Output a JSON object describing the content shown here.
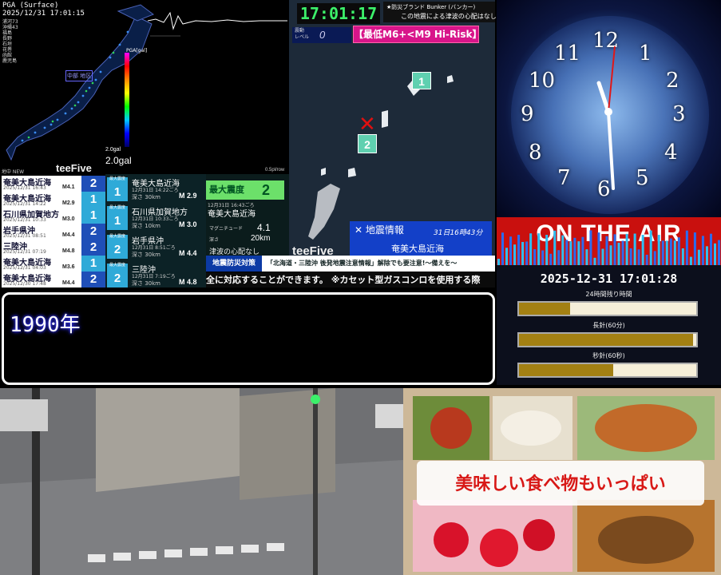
{
  "seismic": {
    "title": "PGA (Surface)",
    "timestamp": "2025/12/31 17:01:15",
    "scale_unit": "PGA[gal]",
    "gal_small": "2.0gal",
    "gal_value": "2.0gal",
    "logo": "teeFive",
    "spl_label": "0.5pl/row",
    "map_place": "中部 地区",
    "station_names": [
      "浦河73",
      "沖縄43",
      "福島",
      "長野",
      "石垣",
      "花巻",
      "函館",
      "鹿児島"
    ]
  },
  "top_clock": {
    "time": "17:01:17",
    "bunker_line1": "★防災ブランド Bunker (バンカー)",
    "bunker_line2": "この地震による津波の心配はなし"
  },
  "tsunami_map": {
    "level_label_1": "震動",
    "level_label_2": "レベル",
    "level_value": "0",
    "risk_label": "【最低M6+<M9 Hi-Risk】",
    "marker_1": "1",
    "marker_2": "2",
    "epicenter": "✕",
    "quake_title": "✕ 地震情報",
    "quake_time": "31日16時43分",
    "quake_place": "奄美大島近海",
    "logo": "teeFive"
  },
  "event_list": {
    "header": "地中 NEW",
    "rows": [
      {
        "name": "奄美大島近海",
        "date": "2025/12/31 16:43",
        "mag": "M4.1",
        "intensity": "2",
        "color": "#1f4fb8"
      },
      {
        "name": "奄美大島近海",
        "date": "2025/12/31 14:22",
        "mag": "M2.9",
        "intensity": "1",
        "color": "#2faad8"
      },
      {
        "name": "石川県加賀地方",
        "date": "2025/12/31 10:33",
        "mag": "M3.0",
        "intensity": "1",
        "color": "#2faad8"
      },
      {
        "name": "岩手県沖",
        "date": "2025/12/31 08:51",
        "mag": "M4.4",
        "intensity": "2",
        "color": "#1f4fb8"
      },
      {
        "name": "三陸沖",
        "date": "2025/12/31 07:19",
        "mag": "M4.8",
        "intensity": "2",
        "color": "#1f4fb8"
      },
      {
        "name": "奄美大島近海",
        "date": "2025/12/31 04:03",
        "mag": "M3.6",
        "intensity": "1",
        "color": "#2faad8"
      },
      {
        "name": "奄美大島近海",
        "date": "2025/12/30 17:48",
        "mag": "M4.4",
        "intensity": "2",
        "color": "#1f4fb8"
      }
    ]
  },
  "detail_list": [
    {
      "name": "奄美大島近海",
      "date": "12月31日 14:22ごろ",
      "depth": "深さ 30km",
      "mag": "M 2.9",
      "intensity": "1"
    },
    {
      "name": "石川県加賀地方",
      "date": "12月31日 10:33ごろ",
      "depth": "深さ 10km",
      "mag": "M 3.0",
      "intensity": "1"
    },
    {
      "name": "岩手県沖",
      "date": "12月31日 8:51ごろ",
      "depth": "深さ 30km",
      "mag": "M 4.4",
      "intensity": "2"
    },
    {
      "name": "三陸沖",
      "date": "12月31日 7:19ごろ",
      "depth": "深さ 30km",
      "mag": "M 4.8",
      "intensity": "2"
    }
  ],
  "max_intensity": {
    "label": "最大震度",
    "value": "2",
    "date": "12月31日 16:43ごろ",
    "place": "奄美大島近海",
    "mag_label": "マグニチュード",
    "mag_value": "4.1",
    "depth_label": "深さ",
    "depth_value": "20km",
    "tsunami_note": "津波の心配なし"
  },
  "ticker": {
    "tag": "地震防災対策",
    "headline": "「北海道・三陸沖 後発地震注意情報」解除でも要注意!～備えを～",
    "scroll_text": "全に対応することができます。 ※カセット型ガスコンロを使用する際"
  },
  "main_text": {
    "year": "1990年"
  },
  "right_clock": {
    "numbers": [
      "12",
      "1",
      "2",
      "3",
      "4",
      "5",
      "6",
      "7",
      "8",
      "9",
      "10",
      "11"
    ],
    "on_air": "ON THE AIR",
    "datetime": "2025-12-31 17:01:28",
    "progress": [
      {
        "label": "24時間残り時間",
        "fraction": 0.29
      },
      {
        "label": "長針(60分)",
        "fraction": 0.98
      },
      {
        "label": "秒針(60秒)",
        "fraction": 0.53
      }
    ]
  },
  "food": {
    "banner": "美味しい食べ物もいっぱい"
  }
}
